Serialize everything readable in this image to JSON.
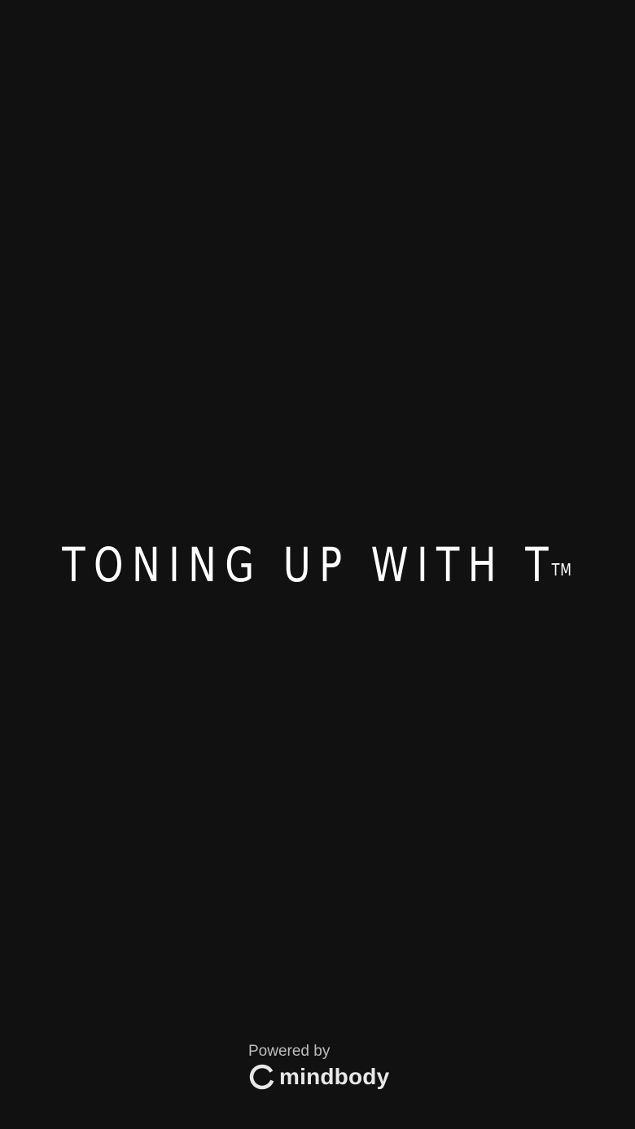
{
  "splash": {
    "brand_title": "TONING UP WITH T",
    "brand_mark": "TM"
  },
  "footer": {
    "powered_by": "Powered by",
    "provider_name": "mindbody",
    "provider_icon": "mindbody-logo-icon"
  },
  "colors": {
    "background": "#111111",
    "brand_text": "#ffffff",
    "footer_text": "#bdbdbd"
  }
}
